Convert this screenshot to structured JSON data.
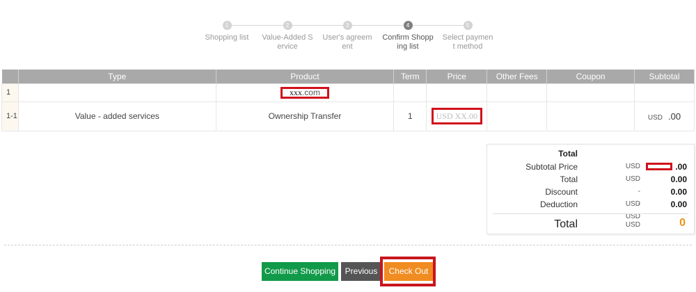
{
  "steps": [
    {
      "num": "1",
      "label": "Shopping list",
      "active": false
    },
    {
      "num": "2",
      "label": "Value-Added S\nervice",
      "active": false
    },
    {
      "num": "3",
      "label": "User's agreem\nent",
      "active": false
    },
    {
      "num": "4",
      "label": "Confirm Shopp\ning list",
      "active": true
    },
    {
      "num": "5",
      "label": "Select paymen\nt method",
      "active": false
    }
  ],
  "table": {
    "headers": [
      "",
      "Type",
      "Product",
      "Term",
      "Price",
      "Other Fees",
      "Coupon",
      "Subtotal"
    ],
    "row1": {
      "no": "1",
      "domain_mask": "xxx",
      "domain_tld": ".com"
    },
    "row2": {
      "no": "1-1",
      "type": "Value - added services",
      "product": "Ownership Transfer",
      "term": "1",
      "price": "USD XX.00",
      "subtotal_currency": "USD",
      "subtotal_value": ".00"
    }
  },
  "summary": {
    "title": "Total",
    "rows": [
      {
        "label": "Subtotal Price",
        "currency": "USD",
        "value": ".00"
      },
      {
        "label": "Total",
        "currency": "USD",
        "value": "0.00"
      },
      {
        "label": "Discount",
        "currency": "-USD",
        "value": "0.00"
      },
      {
        "label": "Deduction",
        "currency": "-USD",
        "value": "0.00"
      }
    ],
    "total_label": "Total",
    "total_currency": "USD",
    "total_value": "0"
  },
  "buttons": {
    "continue": "Continue Shopping",
    "previous": "Previous",
    "checkout": "Check Out"
  },
  "colors": {
    "accent_orange": "#f08c21",
    "continue_green": "#119a49",
    "previous_gray": "#555555",
    "highlight_red": "#d0111b",
    "total_orange": "#e8931d"
  }
}
